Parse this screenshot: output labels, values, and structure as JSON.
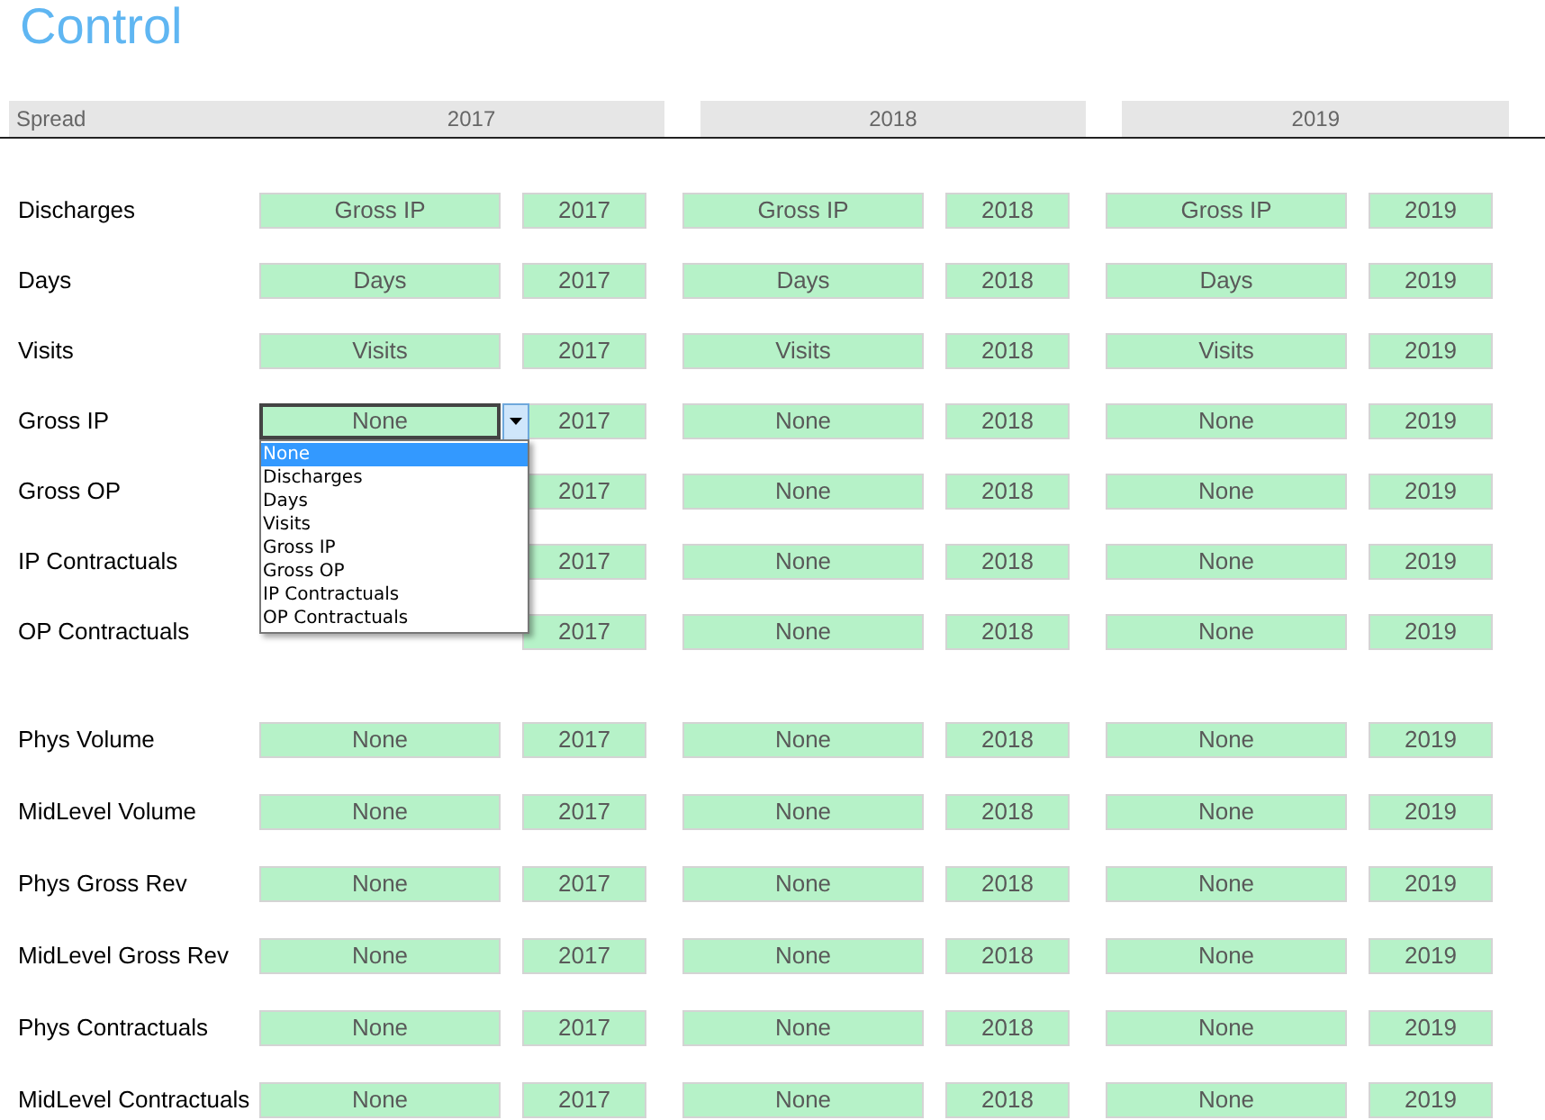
{
  "title": "Control",
  "header": {
    "label": "Spread",
    "years": [
      "2017",
      "2018",
      "2019"
    ]
  },
  "sections": [
    {
      "rows": [
        {
          "label": "Discharges",
          "cells": [
            {
              "metric": "Gross IP",
              "year": "2017"
            },
            {
              "metric": "Gross IP",
              "year": "2018"
            },
            {
              "metric": "Gross IP",
              "year": "2019"
            }
          ]
        },
        {
          "label": "Days",
          "cells": [
            {
              "metric": "Days",
              "year": "2017"
            },
            {
              "metric": "Days",
              "year": "2018"
            },
            {
              "metric": "Days",
              "year": "2019"
            }
          ]
        },
        {
          "label": "Visits",
          "cells": [
            {
              "metric": "Visits",
              "year": "2017"
            },
            {
              "metric": "Visits",
              "year": "2018"
            },
            {
              "metric": "Visits",
              "year": "2019"
            }
          ]
        },
        {
          "label": "Gross IP",
          "cells": [
            {
              "metric": "None",
              "year": "2017",
              "active": true,
              "options": [
                {
                  "label": "None",
                  "selected": true
                },
                {
                  "label": "Discharges",
                  "selected": false
                },
                {
                  "label": "Days",
                  "selected": false
                },
                {
                  "label": "Visits",
                  "selected": false
                },
                {
                  "label": "Gross IP",
                  "selected": false
                },
                {
                  "label": "Gross OP",
                  "selected": false
                },
                {
                  "label": "IP Contractuals",
                  "selected": false
                },
                {
                  "label": "OP Contractuals",
                  "selected": false
                }
              ]
            },
            {
              "metric": "None",
              "year": "2018"
            },
            {
              "metric": "None",
              "year": "2019"
            }
          ]
        },
        {
          "label": "Gross OP",
          "cells": [
            {
              "year": "2017"
            },
            {
              "metric": "None",
              "year": "2018"
            },
            {
              "metric": "None",
              "year": "2019"
            }
          ]
        },
        {
          "label": "IP Contractuals",
          "cells": [
            {
              "year": "2017"
            },
            {
              "metric": "None",
              "year": "2018"
            },
            {
              "metric": "None",
              "year": "2019"
            }
          ]
        },
        {
          "label": "OP Contractuals",
          "cells": [
            {
              "year": "2017"
            },
            {
              "metric": "None",
              "year": "2018"
            },
            {
              "metric": "None",
              "year": "2019"
            }
          ]
        }
      ]
    },
    {
      "rows": [
        {
          "label": "Phys Volume",
          "cells": [
            {
              "metric": "None",
              "year": "2017"
            },
            {
              "metric": "None",
              "year": "2018"
            },
            {
              "metric": "None",
              "year": "2019"
            }
          ]
        },
        {
          "label": "MidLevel Volume",
          "cells": [
            {
              "metric": "None",
              "year": "2017"
            },
            {
              "metric": "None",
              "year": "2018"
            },
            {
              "metric": "None",
              "year": "2019"
            }
          ]
        },
        {
          "label": "Phys Gross Rev",
          "cells": [
            {
              "metric": "None",
              "year": "2017"
            },
            {
              "metric": "None",
              "year": "2018"
            },
            {
              "metric": "None",
              "year": "2019"
            }
          ]
        },
        {
          "label": "MidLevel Gross Rev",
          "cells": [
            {
              "metric": "None",
              "year": "2017"
            },
            {
              "metric": "None",
              "year": "2018"
            },
            {
              "metric": "None",
              "year": "2019"
            }
          ]
        },
        {
          "label": "Phys Contractuals",
          "cells": [
            {
              "metric": "None",
              "year": "2017"
            },
            {
              "metric": "None",
              "year": "2018"
            },
            {
              "metric": "None",
              "year": "2019"
            }
          ]
        },
        {
          "label": "MidLevel Contractuals",
          "cells": [
            {
              "metric": "None",
              "year": "2017"
            },
            {
              "metric": "None",
              "year": "2018"
            },
            {
              "metric": "None",
              "year": "2019"
            }
          ]
        }
      ]
    }
  ]
}
